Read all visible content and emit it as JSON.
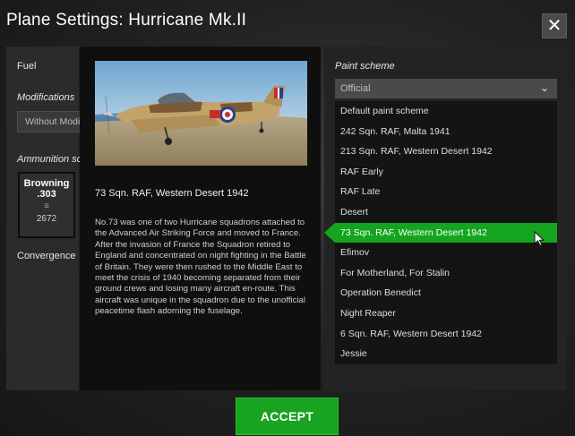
{
  "window": {
    "title": "Plane Settings: Hurricane Mk.II",
    "close_label": "✕"
  },
  "left": {
    "fuel_label": "Fuel",
    "modifications_label": "Modifications",
    "modifications_value": "Without Modifications",
    "ammunition_label": "Ammunition scheme",
    "ammo": {
      "name": "Browning .303",
      "count": "2672"
    },
    "convergence_label": "Convergence"
  },
  "center": {
    "scheme_heading": "73 Sqn. RAF, Western Desert 1942",
    "description": "No.73 was one of two Hurricane squadrons attached to the Advanced Air Striking Force and moved to France. After the invasion of France the Squadron retired to England and concentrated on night fighting in the Battle of Britain. They were then rushed to the Middle East to meet the crisis of 1940 becoming separated from their ground crews and losing many aircraft en-route. This aircraft was unique in the squadron due to the unofficial peacetime flash adorning the fuselage."
  },
  "paint": {
    "label": "Paint scheme",
    "selected_filter": "Official",
    "items": [
      "Default paint scheme",
      "242 Sqn. RAF, Malta 1941",
      "213 Sqn. RAF, Western Desert 1942",
      "RAF Early",
      "RAF Late",
      "Desert",
      "73 Sqn. RAF, Western Desert 1942",
      "Efimov",
      "For Motherland, For Stalin",
      "Operation Benedict",
      "Night Reaper",
      "6 Sqn. RAF, Western Desert 1942",
      "Jessie"
    ],
    "selected_index": 6
  },
  "footer": {
    "accept_label": "ACCEPT"
  },
  "colors": {
    "accent_green": "#14a520",
    "panel_dark": "#0f0f0f",
    "panel_mid": "#232323"
  }
}
